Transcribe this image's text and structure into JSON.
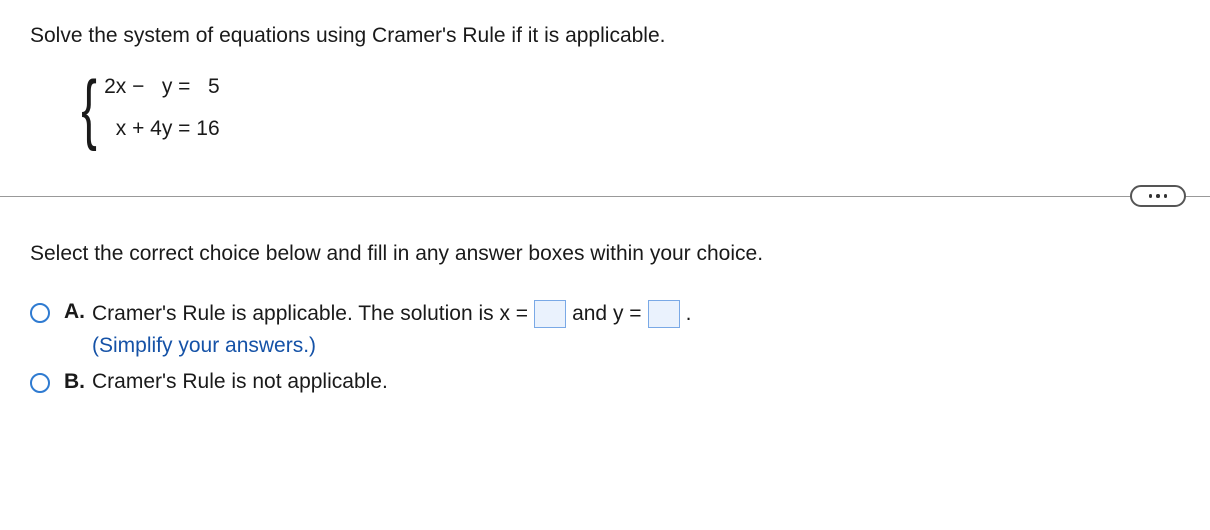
{
  "question": {
    "prompt": "Solve the system of equations using Cramer's Rule if it is applicable.",
    "equations": {
      "row1": "2x −   y =   5",
      "row2": "  x + 4y = 16"
    }
  },
  "instruction": "Select the correct choice below and fill in any answer boxes within your choice.",
  "choices": {
    "a": {
      "label": "A.",
      "text_before_x": "Cramer's Rule is applicable. The solution is x =",
      "text_between": " and y =",
      "text_after": ".",
      "hint": "(Simplify your answers.)"
    },
    "b": {
      "label": "B.",
      "text": "Cramer's Rule is not applicable."
    }
  },
  "more_button": {
    "aria": "More options"
  }
}
